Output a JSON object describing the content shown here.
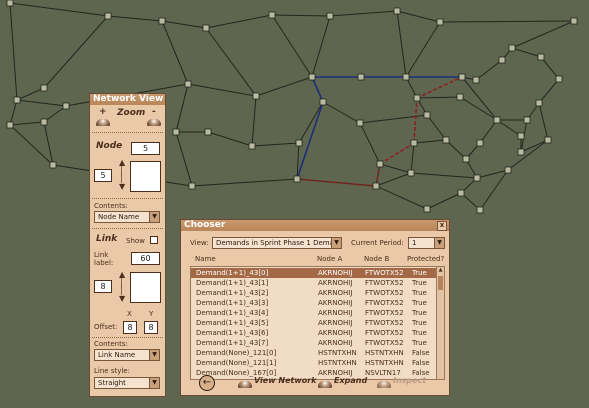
{
  "colors": {
    "background": "#5e6650",
    "route_blue": "#1c2d7a",
    "route_red": "#8c2020",
    "panel": "#e9c9a7"
  },
  "network_view": {
    "title": "Network View",
    "zoom_label": "Zoom",
    "zoom_plus": "+",
    "zoom_minus": "-",
    "node_heading": "Node",
    "node_size": "5",
    "node_size2": "5",
    "node_contents_label": "Contents:",
    "node_contents_value": "Node Name",
    "link_heading": "Link",
    "show_label": "Show",
    "link_label_label": "Link label:",
    "link_label_value": "60",
    "link_width": "8",
    "offset_label": "Offset:",
    "offset_x_label": "X",
    "offset_y_label": "Y",
    "offset_x": "8",
    "offset_y": "8",
    "link_contents_label": "Contents:",
    "link_contents_value": "Link Name",
    "line_style_label": "Line style:",
    "line_style_value": "Straight"
  },
  "chooser": {
    "title": "Chooser",
    "close": "x",
    "view_label": "View:",
    "view_value": "Demands in Sprint Phase 1 Demar",
    "period_label": "Current Period:",
    "period_value": "1",
    "columns": [
      "Name",
      "Node A",
      "Node B",
      "Protected?"
    ],
    "rows": [
      [
        "Demand(1+1)_43[0]",
        "AKRNOHIJ",
        "FTWOTX52",
        "True"
      ],
      [
        "Demand(1+1)_43[1]",
        "AKRNOHIJ",
        "FTWOTX52",
        "True"
      ],
      [
        "Demand(1+1)_43[2]",
        "AKRNOHIJ",
        "FTWOTX52",
        "True"
      ],
      [
        "Demand(1+1)_43[3]",
        "AKRNOHIJ",
        "FTWOTX52",
        "True"
      ],
      [
        "Demand(1+1)_43[4]",
        "AKRNOHIJ",
        "FTWOTX52",
        "True"
      ],
      [
        "Demand(1+1)_43[5]",
        "AKRNOHIJ",
        "FTWOTX52",
        "True"
      ],
      [
        "Demand(1+1)_43[6]",
        "AKRNOHIJ",
        "FTWOTX52",
        "True"
      ],
      [
        "Demand(1+1)_43[7]",
        "AKRNOHIJ",
        "FTWOTX52",
        "True"
      ],
      [
        "Demand(None)_121[0]",
        "HSTNTXHN",
        "HSTNTXHN",
        "False"
      ],
      [
        "Demand(None)_121[1]",
        "HSTNTXHN",
        "HSTNTXHN",
        "False"
      ],
      [
        "Demand(None)_167[0]",
        "AKRNOHIJ",
        "NSVLTN17",
        "False"
      ]
    ],
    "back_icon": "arrow-left-icon",
    "view_network": "View Network",
    "expand": "Expand",
    "inspect": "Inspect"
  }
}
